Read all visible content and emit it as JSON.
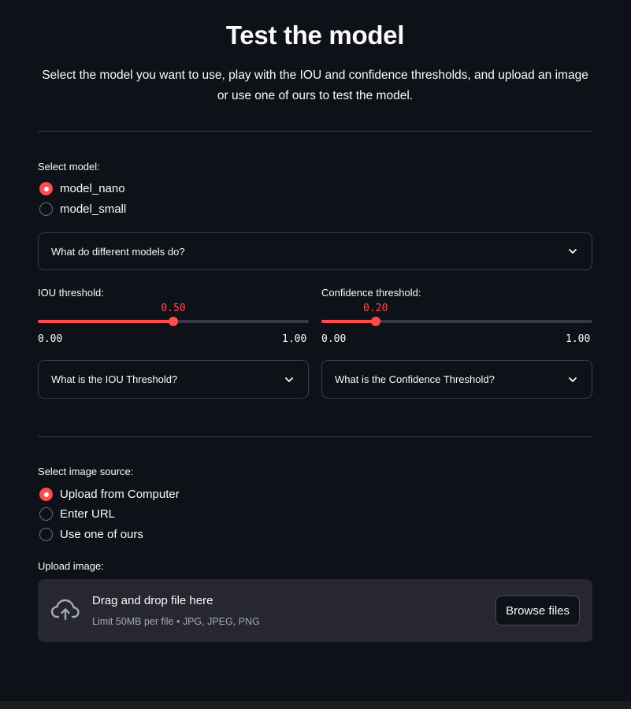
{
  "header": {
    "title": "Test the model",
    "subtitle": "Select the model you want to use, play with the IOU and confidence thresholds, and upload an image or use one of ours to test the model."
  },
  "model": {
    "label": "Select model:",
    "options": [
      "model_nano",
      "model_small"
    ],
    "selected": "model_nano",
    "expander": "What do different models do?"
  },
  "iou": {
    "label": "IOU threshold:",
    "value": "0.50",
    "min": "0.00",
    "max": "1.00",
    "fraction": 0.5,
    "expander": "What is the IOU Threshold?"
  },
  "confidence": {
    "label": "Confidence threshold:",
    "value": "0.20",
    "min": "0.00",
    "max": "1.00",
    "fraction": 0.2,
    "expander": "What is the Confidence Threshold?"
  },
  "source": {
    "label": "Select image source:",
    "options": [
      "Upload from Computer",
      "Enter URL",
      "Use one of ours"
    ],
    "selected": "Upload from Computer"
  },
  "upload": {
    "label": "Upload image:",
    "title": "Drag and drop file here",
    "limits": "Limit 50MB per file • JPG, JPEG, PNG",
    "button": "Browse files",
    "icon": "cloud-upload-icon"
  },
  "colors": {
    "background": "#0e1117",
    "accent": "#ff4b4b",
    "panel": "#262730"
  }
}
